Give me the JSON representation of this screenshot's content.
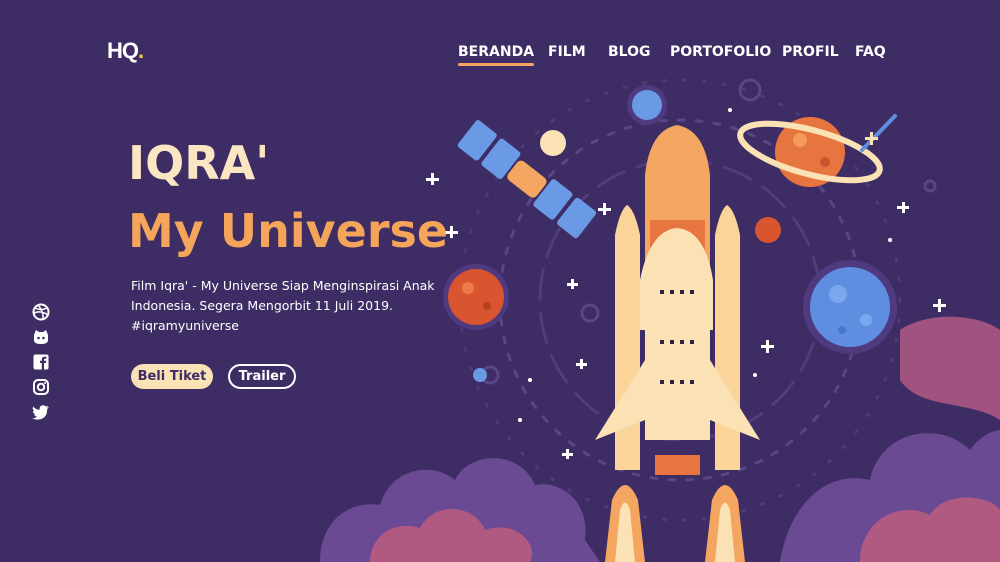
{
  "brand": {
    "logo_text": "HQ",
    "logo_dot": "."
  },
  "nav": {
    "items": [
      {
        "label": "BERANDA",
        "active": true
      },
      {
        "label": "FILM"
      },
      {
        "label": "BLOG"
      },
      {
        "label": "PORTOFOLIO"
      },
      {
        "label": "PROFIL"
      },
      {
        "label": "FAQ"
      }
    ]
  },
  "hero": {
    "title_line1": "IQRA'",
    "title_line2": "My Universe",
    "description": "Film Iqra' - My Universe Siap Menginspirasi Anak Indonesia. Segera Mengorbit 11 Juli 2019. #iqramyuniverse",
    "primary_button": "Beli Tiket",
    "secondary_button": "Trailer"
  },
  "social": [
    "dribbble-icon",
    "github-icon",
    "facebook-icon",
    "instagram-icon",
    "twitter-icon"
  ],
  "colors": {
    "background": "#3d2d64",
    "accent_orange": "#f5a55a",
    "title_cream": "#fbe6c3",
    "button_cream": "#fbe2b4",
    "logo_dot": "#f7d23e"
  }
}
